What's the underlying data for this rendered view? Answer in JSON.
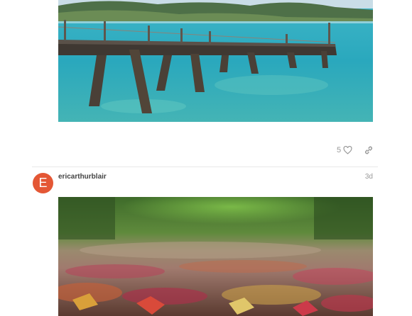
{
  "post1": {
    "image_subject": "wooden-pier-over-turquoise-sea",
    "like_count": "5",
    "like_icon": "heart-icon",
    "link_icon": "link-icon"
  },
  "post2": {
    "avatar_letter": "E",
    "avatar_color": "#e45735",
    "username": "ericarthurblair",
    "time": "3d",
    "image_subject": "fallen-autumn-leaves-on-path"
  }
}
